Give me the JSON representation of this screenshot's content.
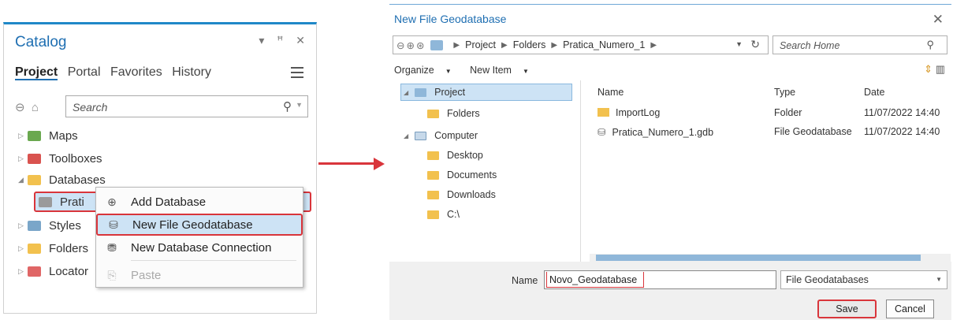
{
  "catalog": {
    "title": "Catalog",
    "window_controls": "▾ ꟸ ✕",
    "tabs": [
      "Project",
      "Portal",
      "Favorites",
      "History"
    ],
    "search_placeholder": "Search",
    "tree": [
      {
        "label": "Maps",
        "icon": "maps-icon",
        "color": "#6aa84f"
      },
      {
        "label": "Toolboxes",
        "icon": "toolbox-icon",
        "color": "#d9534f"
      },
      {
        "label": "Databases",
        "icon": "database-folder-icon",
        "color": "#f2c14e"
      },
      {
        "label": "Prati",
        "icon": "geodatabase-icon",
        "color": "#8a8a8a"
      },
      {
        "label": "Styles",
        "icon": "styles-icon",
        "color": "#7aa6c9"
      },
      {
        "label": "Folders",
        "icon": "folder-icon",
        "color": "#f2c14e"
      },
      {
        "label": "Locator",
        "icon": "locator-icon",
        "color": "#e06666"
      }
    ],
    "context_menu": {
      "add_database": "Add Database",
      "new_file_gdb": "New File Geodatabase",
      "new_db_connection": "New Database Connection",
      "paste": "Paste"
    }
  },
  "dialog": {
    "title": "New File Geodatabase",
    "breadcrumb": [
      "Project",
      "Folders",
      "Pratica_Numero_1"
    ],
    "search_placeholder": "Search Home",
    "toolbar": {
      "organize": "Organize",
      "new_item": "New Item"
    },
    "nav": {
      "project": "Project",
      "folders": "Folders",
      "computer": "Computer",
      "desktop": "Desktop",
      "documents": "Documents",
      "downloads": "Downloads",
      "c_drive": "C:\\"
    },
    "columns": {
      "name": "Name",
      "type": "Type",
      "date": "Date"
    },
    "rows": [
      {
        "name": "ImportLog",
        "type": "Folder",
        "date": "11/07/2022 14:40"
      },
      {
        "name": "Pratica_Numero_1.gdb",
        "type": "File Geodatabase",
        "date": "11/07/2022 14:40"
      }
    ],
    "name_label": "Name",
    "name_value": "Novo_Geodatabase",
    "file_type": "File Geodatabases",
    "save_label": "Save",
    "cancel_label": "Cancel"
  },
  "colors": {
    "accent": "#1f6fb2",
    "highlight": "#d9353b",
    "selection": "#cde3f5"
  }
}
